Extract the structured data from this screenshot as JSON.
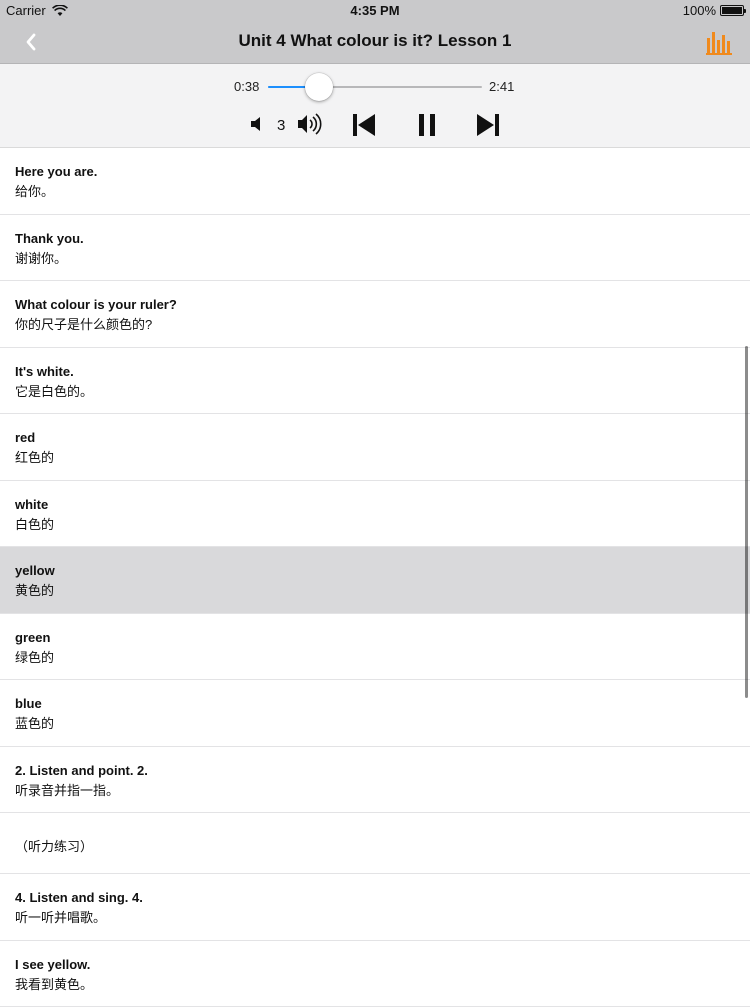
{
  "status_bar": {
    "carrier": "Carrier",
    "wifi_icon": "wifi-icon",
    "time": "4:35 PM",
    "battery": "100%",
    "battery_icon": "battery-icon"
  },
  "nav": {
    "back_icon": "chevron-left-icon",
    "title": "Unit 4 What colour is it? Lesson 1",
    "right_icon": "equalizer-icon",
    "accent_color": "#f08a1d"
  },
  "player": {
    "elapsed": "0:38",
    "total": "2:41",
    "progress": 0.236,
    "volume_value": "3",
    "accent_color": "#1d8ffd"
  },
  "lessons": [
    {
      "en": "Here you are.",
      "zh": "给你。"
    },
    {
      "en": "Thank you.",
      "zh": "谢谢你。"
    },
    {
      "en": "What colour is your ruler?",
      "zh": "你的尺子是什么颜色的?"
    },
    {
      "en": "It's white.",
      "zh": "它是白色的。"
    },
    {
      "en": "red",
      "zh": "红色的"
    },
    {
      "en": "white",
      "zh": "白色的"
    },
    {
      "en": "yellow",
      "zh": "黄色的",
      "selected": true
    },
    {
      "en": "green",
      "zh": "绿色的"
    },
    {
      "en": "blue",
      "zh": "蓝色的"
    },
    {
      "en": "2. Listen and point. 2.",
      "zh": "听录音并指一指。"
    },
    {
      "only": "（听力练习）"
    },
    {
      "en": "4. Listen and sing. 4.",
      "zh": "听一听并唱歌。"
    },
    {
      "en": "I see yellow.",
      "zh": "我看到黄色。"
    }
  ]
}
